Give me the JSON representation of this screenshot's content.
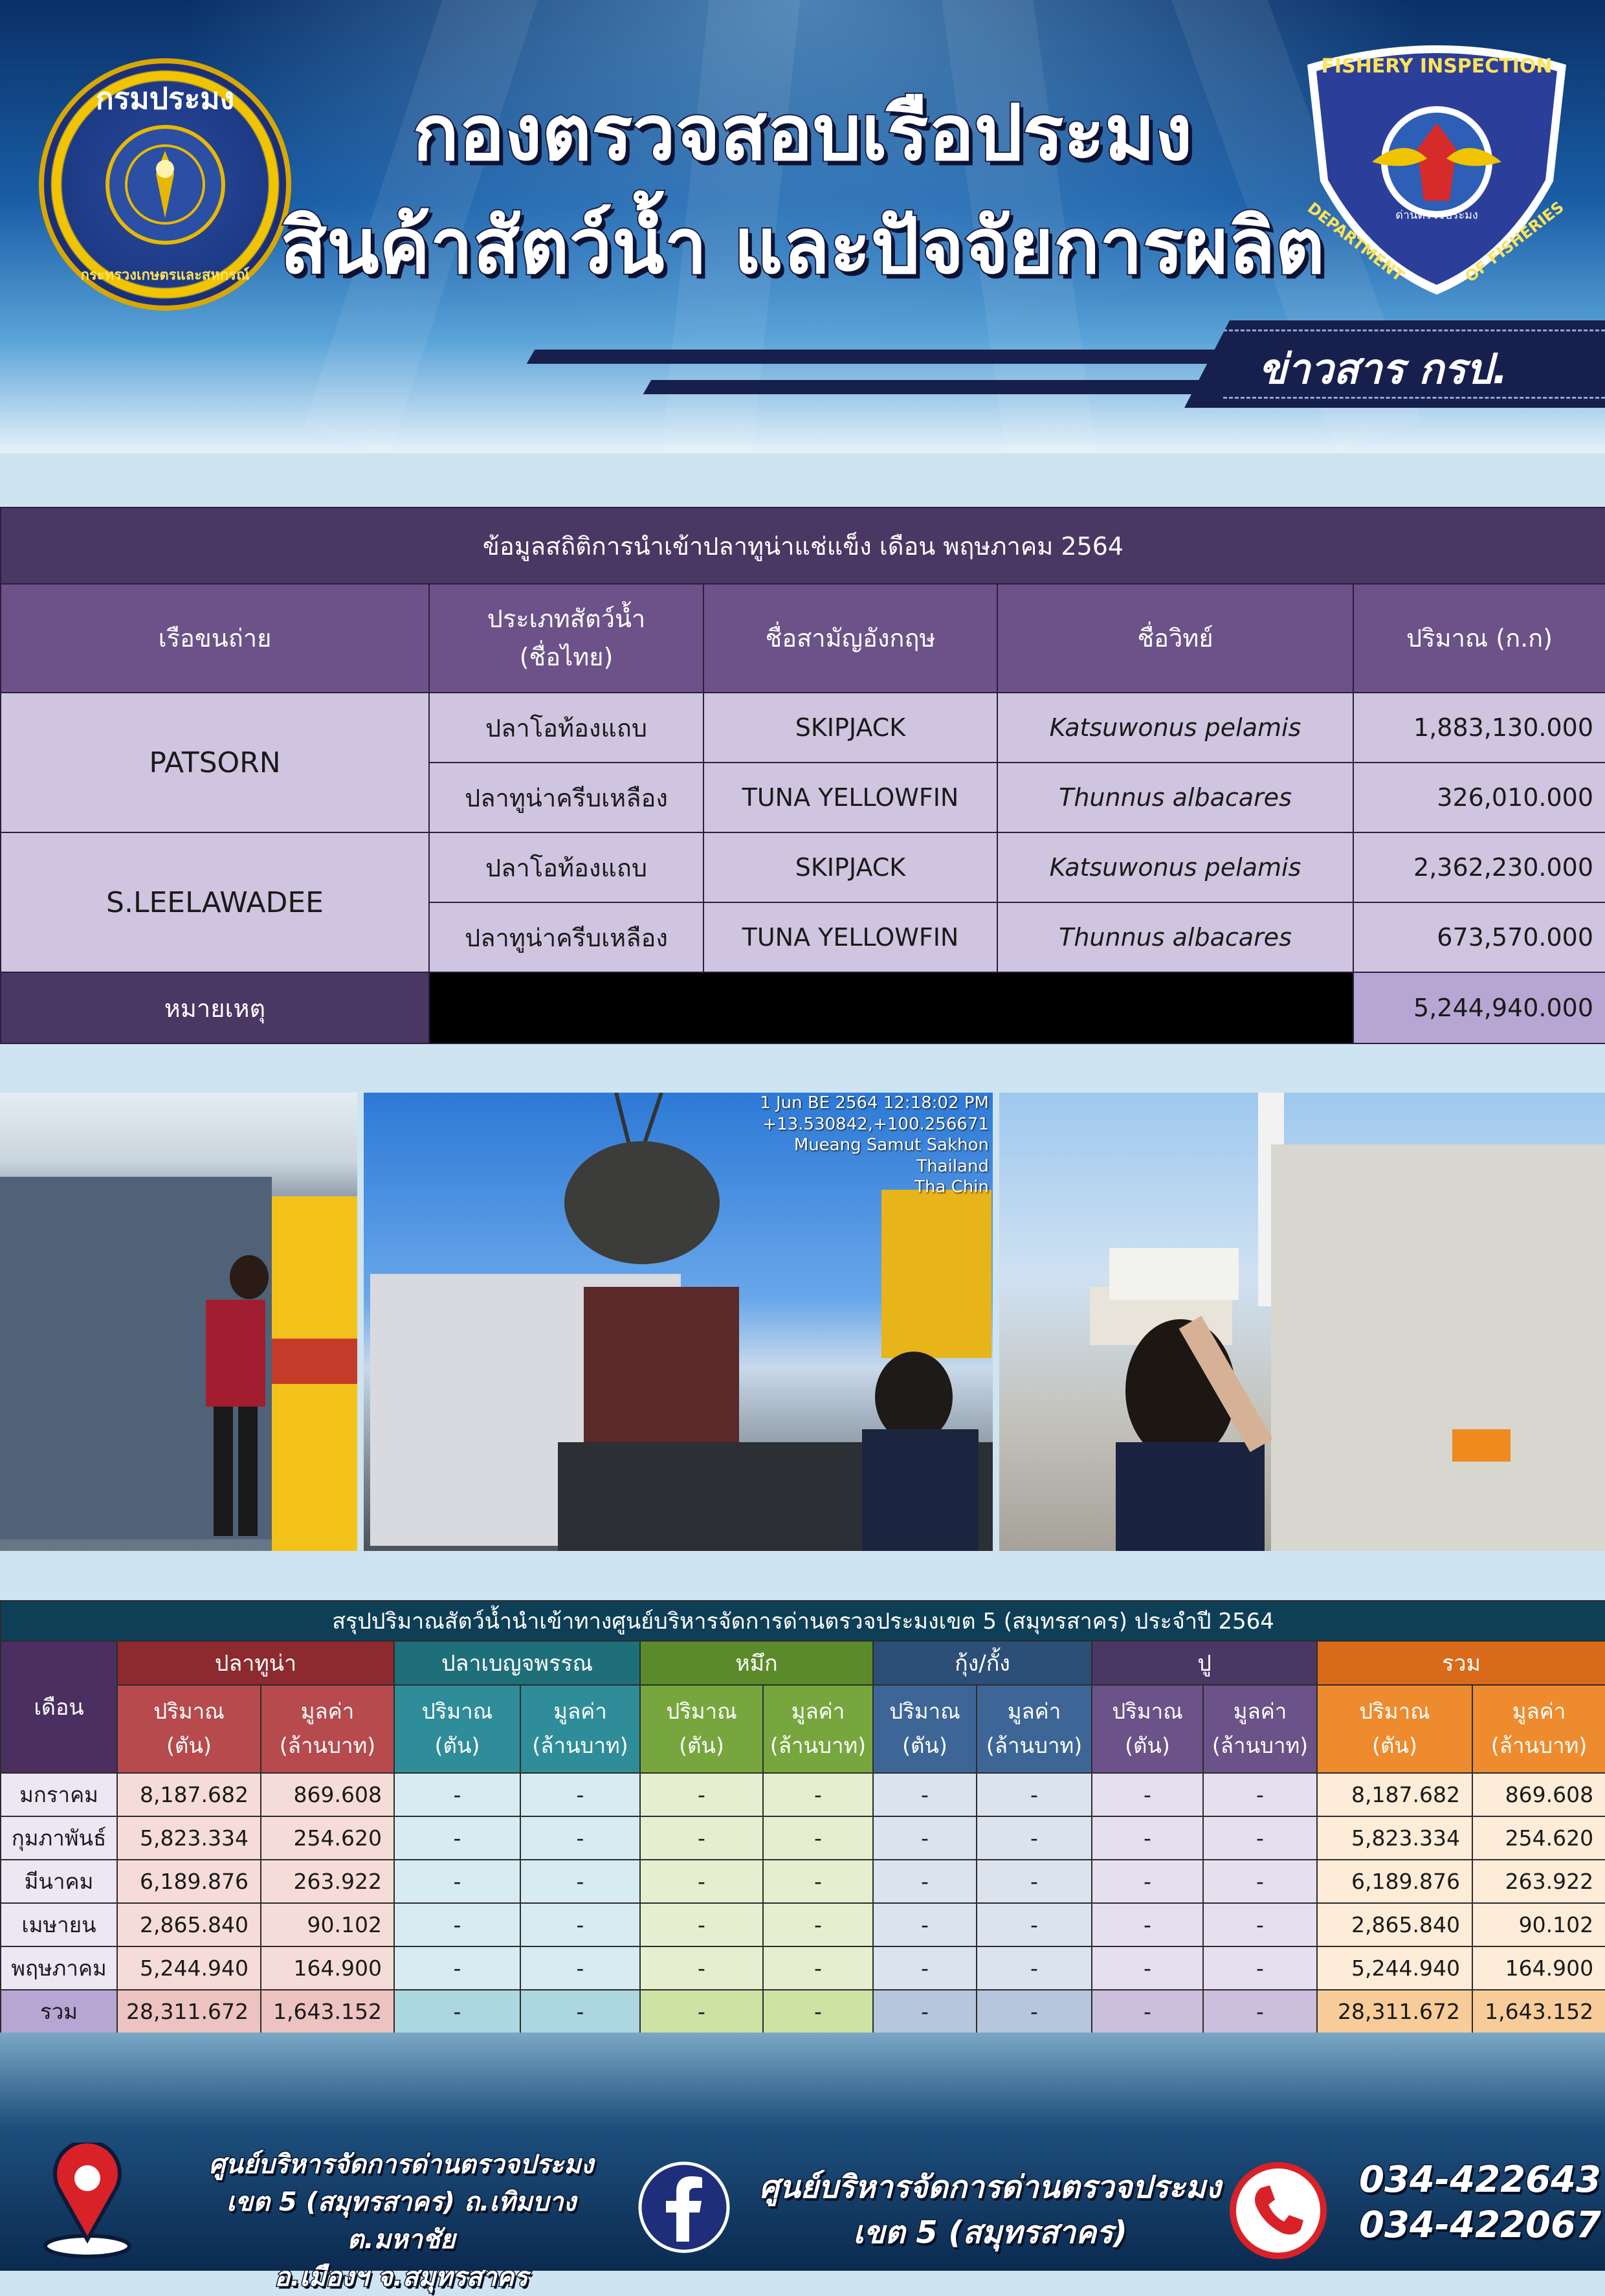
{
  "header": {
    "title_line1": "กองตรวจสอบเรือประมง",
    "title_line2": "สินค้าสัตว์น้ำ และปัจจัยการผลิต",
    "news_label": "ข่าวสาร กรป.",
    "seal_top_text": "กรมประมง",
    "seal_bottom_text": "กระทรวงเกษตรและสหกรณ์",
    "badge_top_text": "FISHERY INSPECTION",
    "badge_left_text": "DEPARTMENT",
    "badge_right_text": "OF FISHERIES",
    "badge_center_text": "ด่านตรวจประมง"
  },
  "import_table": {
    "caption": "ข้อมูลสถิติการนำเข้าปลาทูน่าแช่แข็ง เดือน พฤษภาคม 2564",
    "headers": {
      "vessel": "เรือขนถ่าย",
      "thai_type_1": "ประเภทสัตว์น้ำ",
      "thai_type_2": "(ชื่อไทย)",
      "common_name": "ชื่อสามัญอังกฤษ",
      "scientific_name": "ชื่อวิทย์",
      "quantity": "ปริมาณ (ก.ก)"
    },
    "vessels": [
      {
        "name": "PATSORN",
        "rows": [
          {
            "thai": "ปลาโอท้องแถบ",
            "common": "SKIPJACK",
            "sci": "Katsuwonus pelamis",
            "qty": "1,883,130.000"
          },
          {
            "thai": "ปลาทูน่าครีบเหลือง",
            "common": "TUNA YELLOWFIN",
            "sci": "Thunnus albacares",
            "qty": "326,010.000"
          }
        ]
      },
      {
        "name": "S.LEELAWADEE",
        "rows": [
          {
            "thai": "ปลาโอท้องแถบ",
            "common": "SKIPJACK",
            "sci": "Katsuwonus pelamis",
            "qty": "2,362,230.000"
          },
          {
            "thai": "ปลาทูน่าครีบเหลือง",
            "common": "TUNA YELLOWFIN",
            "sci": "Thunnus albacares",
            "qty": "673,570.000"
          }
        ]
      }
    ],
    "note_label": "หมายเหตุ",
    "total": "5,244,940.000"
  },
  "photos": {
    "photo2_stamp": [
      "1 Jun BE 2564 12:18:02 PM",
      "+13.530842,+100.256671",
      "",
      "Mueang Samut Sakhon",
      "Thailand",
      "Tha Chin"
    ]
  },
  "summary_table": {
    "caption": "สรุปปริมาณสัตว์น้ำนำเข้าทางศูนย์บริหารจัดการด่านตรวจประมงเขต 5 (สมุทรสาคร) ประจำปี 2564",
    "month_header": "เดือน",
    "groups": [
      "ปลาทูน่า",
      "ปลาเบญจพรรณ",
      "หมึก",
      "กุ้ง/กั้ง",
      "ปู",
      "รวม"
    ],
    "sub_qty_1": "ปริมาณ",
    "sub_qty_2": "(ตัน)",
    "sub_val_1": "มูลค่า",
    "sub_val_2": "(ล้านบาท)",
    "rows": [
      {
        "month": "มกราคม",
        "cells": [
          "8,187.682",
          "869.608",
          "-",
          "-",
          "-",
          "-",
          "-",
          "-",
          "-",
          "-",
          "8,187.682",
          "869.608"
        ]
      },
      {
        "month": "กุมภาพันธ์",
        "cells": [
          "5,823.334",
          "254.620",
          "-",
          "-",
          "-",
          "-",
          "-",
          "-",
          "-",
          "-",
          "5,823.334",
          "254.620"
        ]
      },
      {
        "month": "มีนาคม",
        "cells": [
          "6,189.876",
          "263.922",
          "-",
          "-",
          "-",
          "-",
          "-",
          "-",
          "-",
          "-",
          "6,189.876",
          "263.922"
        ]
      },
      {
        "month": "เมษายน",
        "cells": [
          "2,865.840",
          "90.102",
          "-",
          "-",
          "-",
          "-",
          "-",
          "-",
          "-",
          "-",
          "2,865.840",
          "90.102"
        ]
      },
      {
        "month": "พฤษภาคม",
        "cells": [
          "5,244.940",
          "164.900",
          "-",
          "-",
          "-",
          "-",
          "-",
          "-",
          "-",
          "-",
          "5,244.940",
          "164.900"
        ]
      }
    ],
    "total": {
      "month": "รวม",
      "cells": [
        "28,311.672",
        "1,643.152",
        "-",
        "-",
        "-",
        "-",
        "-",
        "-",
        "-",
        "-",
        "28,311.672",
        "1,643.152"
      ]
    }
  },
  "footer": {
    "address_line1": "ศูนย์บริหารจัดการด่านตรวจประมง",
    "address_line2": "เขต 5 (สมุทรสาคร) ถ.เทิมบาง ต.มหาชัย",
    "address_line3": "อ.เมืองฯ จ.สมุทรสาคร",
    "facebook_line1": "ศูนย์บริหารจัดการด่านตรวจประมง",
    "facebook_line2": "เขต 5 (สมุทรสาคร)",
    "phone1": "034-422643",
    "phone2": "034-422067"
  }
}
